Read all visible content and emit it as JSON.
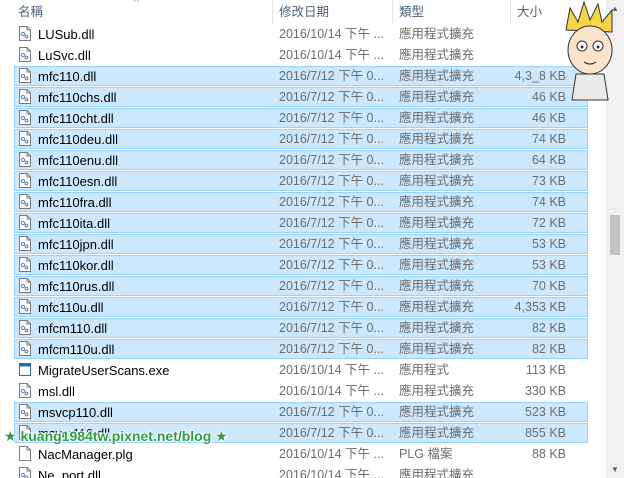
{
  "header": {
    "name_label": "名稱",
    "date_label": "修改日期",
    "type_label": "類型",
    "size_label": "大小"
  },
  "files": [
    {
      "name": "LUSub.dll",
      "date": "2016/10/14 下午 ...",
      "type": "應用程式擴充",
      "size": "",
      "selected": false,
      "icon": "dll-file-icon"
    },
    {
      "name": "LuSvc.dll",
      "date": "2016/10/14 下午 ...",
      "type": "應用程式擴充",
      "size": "",
      "selected": false,
      "icon": "dll-file-icon"
    },
    {
      "name": "mfc110.dll",
      "date": "2016/7/12 下午 0...",
      "type": "應用程式擴充",
      "size": "4,3_8 KB",
      "selected": true,
      "icon": "dll-file-icon"
    },
    {
      "name": "mfc110chs.dll",
      "date": "2016/7/12 下午 0...",
      "type": "應用程式擴充",
      "size": "46 KB",
      "selected": true,
      "icon": "dll-file-icon"
    },
    {
      "name": "mfc110cht.dll",
      "date": "2016/7/12 下午 0...",
      "type": "應用程式擴充",
      "size": "46 KB",
      "selected": true,
      "icon": "dll-file-icon"
    },
    {
      "name": "mfc110deu.dll",
      "date": "2016/7/12 下午 0...",
      "type": "應用程式擴充",
      "size": "74 KB",
      "selected": true,
      "icon": "dll-file-icon"
    },
    {
      "name": "mfc110enu.dll",
      "date": "2016/7/12 下午 0...",
      "type": "應用程式擴充",
      "size": "64 KB",
      "selected": true,
      "icon": "dll-file-icon"
    },
    {
      "name": "mfc110esn.dll",
      "date": "2016/7/12 下午 0...",
      "type": "應用程式擴充",
      "size": "73 KB",
      "selected": true,
      "icon": "dll-file-icon"
    },
    {
      "name": "mfc110fra.dll",
      "date": "2016/7/12 下午 0...",
      "type": "應用程式擴充",
      "size": "74 KB",
      "selected": true,
      "icon": "dll-file-icon"
    },
    {
      "name": "mfc110ita.dll",
      "date": "2016/7/12 下午 0...",
      "type": "應用程式擴充",
      "size": "72 KB",
      "selected": true,
      "icon": "dll-file-icon"
    },
    {
      "name": "mfc110jpn.dll",
      "date": "2016/7/12 下午 0...",
      "type": "應用程式擴充",
      "size": "53 KB",
      "selected": true,
      "icon": "dll-file-icon"
    },
    {
      "name": "mfc110kor.dll",
      "date": "2016/7/12 下午 0...",
      "type": "應用程式擴充",
      "size": "53 KB",
      "selected": true,
      "icon": "dll-file-icon"
    },
    {
      "name": "mfc110rus.dll",
      "date": "2016/7/12 下午 0...",
      "type": "應用程式擴充",
      "size": "70 KB",
      "selected": true,
      "icon": "dll-file-icon"
    },
    {
      "name": "mfc110u.dll",
      "date": "2016/7/12 下午 0...",
      "type": "應用程式擴充",
      "size": "4,353 KB",
      "selected": true,
      "icon": "dll-file-icon"
    },
    {
      "name": "mfcm110.dll",
      "date": "2016/7/12 下午 0...",
      "type": "應用程式擴充",
      "size": "82 KB",
      "selected": true,
      "icon": "dll-file-icon"
    },
    {
      "name": "mfcm110u.dll",
      "date": "2016/7/12 下午 0...",
      "type": "應用程式擴充",
      "size": "82 KB",
      "selected": true,
      "icon": "dll-file-icon"
    },
    {
      "name": "MigrateUserScans.exe",
      "date": "2016/10/14 下午 ...",
      "type": "應用程式",
      "size": "113 KB",
      "selected": false,
      "icon": "exe-file-icon"
    },
    {
      "name": "msl.dll",
      "date": "2016/10/14 下午 ...",
      "type": "應用程式擴充",
      "size": "330 KB",
      "selected": false,
      "icon": "dll-file-icon"
    },
    {
      "name": "msvcp110.dll",
      "date": "2016/7/12 下午 0...",
      "type": "應用程式擴充",
      "size": "523 KB",
      "selected": true,
      "icon": "dll-file-icon"
    },
    {
      "name": "msvcr110.dll",
      "date": "2016/7/12 下午 0...",
      "type": "應用程式擴充",
      "size": "855 KB",
      "selected": true,
      "icon": "dll-file-icon"
    },
    {
      "name": "NacManager.plg",
      "date": "2016/10/14 下午 ...",
      "type": "PLG 檔案",
      "size": "88 KB",
      "selected": false,
      "icon": "plg-file-icon"
    },
    {
      "name": "Ne..port.dll",
      "date": "2016/10/14 下午 ...",
      "type": "應用程式擴充",
      "size": "",
      "selected": false,
      "icon": "dll-file-icon"
    }
  ],
  "watermark": "★ kuang1984tw.pixnet.net/blog ★",
  "colors": {
    "selection_bg": "#cce8ff",
    "selection_border": "#99d1ff",
    "header_text": "#4c607a",
    "watermark": "#2e9e4b"
  }
}
